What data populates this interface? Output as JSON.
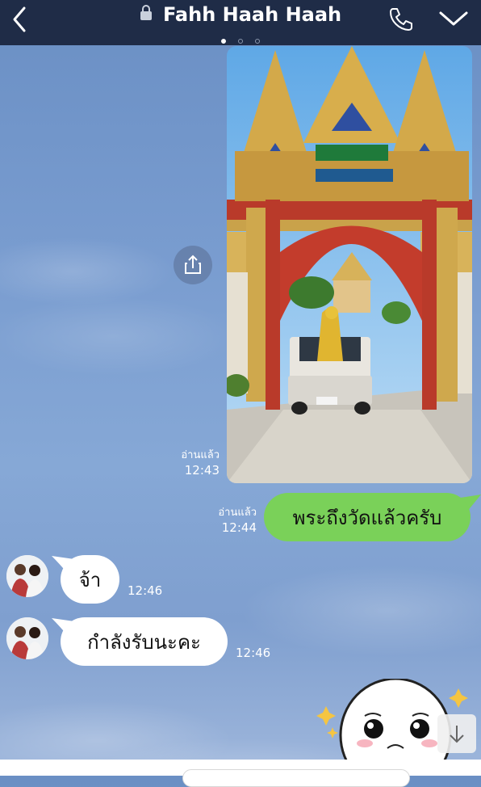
{
  "header": {
    "title": "Fahh Haah Haah",
    "page_dots": 3,
    "active_dot": 1
  },
  "messages": {
    "image_read_status": "อ่านแล้ว",
    "image_time": "12:43",
    "outgoing_text": "พระถึงวัดแล้วครับ",
    "outgoing_read_status": "อ่านแล้ว",
    "outgoing_time": "12:44",
    "incoming": [
      {
        "text": "จ้า",
        "time": "12:46"
      },
      {
        "text": "กำลังรับนะคะ",
        "time": "12:46"
      }
    ]
  },
  "icons": {
    "back": "back-chevron-icon",
    "lock": "lock-icon",
    "call": "phone-icon",
    "more": "chevron-down-icon",
    "share": "share-icon",
    "scroll": "arrow-down-icon"
  },
  "colors": {
    "header": "#1f2c47",
    "outgoing_bubble": "#7ad159",
    "incoming_bubble": "#ffffff"
  }
}
